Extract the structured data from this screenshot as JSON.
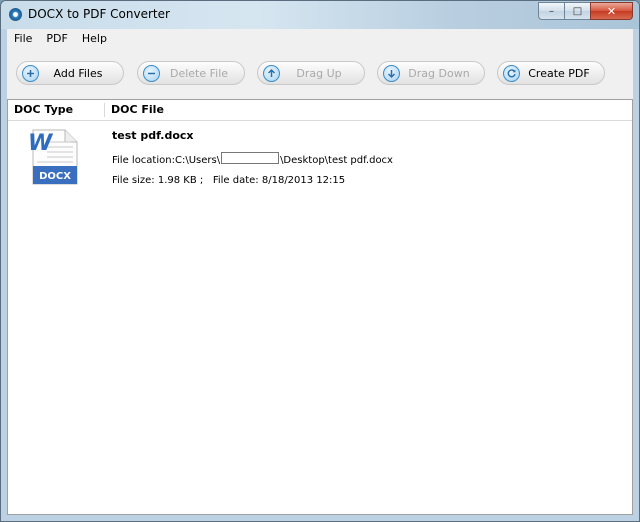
{
  "window": {
    "title": "DOCX to PDF Converter",
    "minimize_glyph": "–",
    "maximize_glyph": "□",
    "close_glyph": "✕"
  },
  "menu": [
    "File",
    "PDF",
    "Help"
  ],
  "toolbar": {
    "add_files": "Add Files",
    "delete_file": "Delete File",
    "drag_up": "Drag Up",
    "drag_down": "Drag Down",
    "create_pdf": "Create PDF"
  },
  "list": {
    "headers": {
      "doc_type": "DOC Type",
      "doc_file": "DOC File"
    },
    "icon_label": "DOCX",
    "icon_letter": "W",
    "items": [
      {
        "name": "test pdf.docx",
        "location_label": "File location:",
        "location_prefix": "C:\\Users\\",
        "location_suffix": "\\Desktop\\test pdf.docx",
        "size_label": "File size:",
        "size": "1.98 KB ;",
        "date_label": "File date:",
        "date": "8/18/2013 12:15"
      }
    ]
  },
  "colors": {
    "docx_blue": "#3a6fbf",
    "icon_accent": "#3d8cc5",
    "close_red": "#c43b23"
  }
}
